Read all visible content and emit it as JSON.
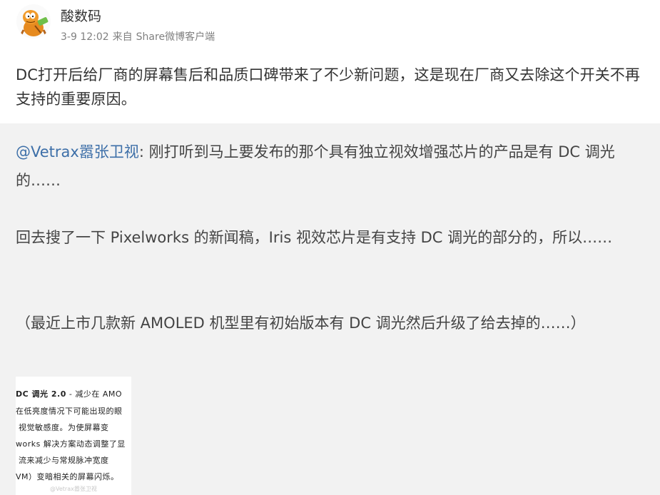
{
  "header": {
    "nickname": "酸数码",
    "time": "3-9 12:02",
    "source_prefix": "来自",
    "source": "Share微博客户端"
  },
  "post": {
    "text": "DC打开后给厂商的屏幕售后和品质口碑带来了不少新问题，这是现在厂商又去除这个开关不再支持的重要原因。"
  },
  "repost": {
    "mention": "@Vetrax嚣张卫视",
    "para1": ": 刚打听到马上要发布的那个具有独立视效增强芯片的产品是有 DC 调光的……",
    "para2": "回去搜了一下 Pixelworks 的新闻稿，Iris 视效芯片是有支持 DC 调光的部分的，所以……",
    "para3": "（最近上市几款新 AMOLED 机型里有初始版本有 DC 调光然后升级了给去掉的……）",
    "image": {
      "lines": [
        "DC 调光 2.0",
        " - 减少在 AMO",
        "在低亮度情况下可能出现的眼",
        "视觉敏感度。为使屏幕变",
        "works 解决方案动态调整了显",
        "流来减少与常规脉冲宽度",
        "VM）变暗相关的屏幕闪烁。"
      ],
      "watermark": "@Vetrax嚣张卫视"
    }
  }
}
